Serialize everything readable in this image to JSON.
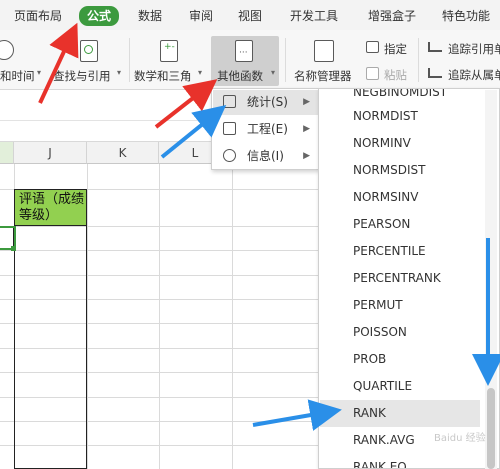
{
  "tabs": [
    "页面布局",
    "公式",
    "数据",
    "审阅",
    "视图",
    "开发工具",
    "增强盒子",
    "特色功能"
  ],
  "ribbon": {
    "date_time": "和时间",
    "lookup": "查找与引用",
    "math": "数学和三角",
    "other_functions": "其他函数",
    "name_manager": "名称管理器",
    "specify": "指定",
    "paste": "粘贴",
    "trace_precedents": "追踪引用单",
    "trace_dependents": "追踪从属单"
  },
  "columns": [
    "J",
    "K",
    "L"
  ],
  "cell": {
    "header_text": "评语（成绩等级）"
  },
  "submenu": {
    "items": [
      {
        "label": "统计(S)",
        "icon": "chart-icon"
      },
      {
        "label": "工程(E)",
        "icon": "engineering-icon"
      },
      {
        "label": "信息(I)",
        "icon": "info-icon"
      }
    ]
  },
  "functions": [
    "NEGBINOMDIST",
    "NORMDIST",
    "NORMINV",
    "NORMSDIST",
    "NORMSINV",
    "PEARSON",
    "PERCENTILE",
    "PERCENTRANK",
    "PERMUT",
    "POISSON",
    "PROB",
    "QUARTILE",
    "RANK",
    "RANK.AVG",
    "RANK.EQ"
  ],
  "highlighted_function": "RANK",
  "colors": {
    "active_tab": "#3c9a3e",
    "cell_fill": "#92d050",
    "arrow_red": "#e8322b",
    "arrow_blue": "#2a8fe8"
  },
  "watermark": "Baidu 经验"
}
